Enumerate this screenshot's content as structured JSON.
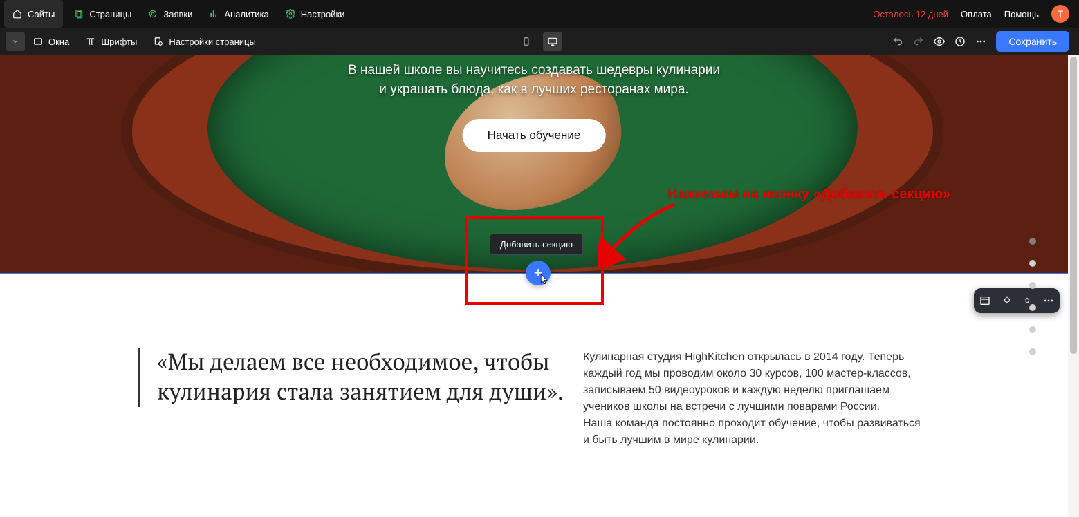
{
  "topbar": {
    "items": [
      {
        "label": "Сайты"
      },
      {
        "label": "Страницы"
      },
      {
        "label": "Заявки"
      },
      {
        "label": "Аналитика"
      },
      {
        "label": "Настройки"
      }
    ],
    "trial": "Осталось 12 дней",
    "payment": "Оплата",
    "help": "Помощь",
    "avatar_letter": "Т"
  },
  "secondbar": {
    "windows": "Окна",
    "fonts": "Шрифты",
    "page_settings": "Настройки страницы",
    "save": "Сохранить"
  },
  "hero": {
    "subtitle": "В нашей школе вы научитесь создавать шедевры кулинарии\nи украшать блюда, как в лучших ресторанах мира.",
    "cta_button": "Начать обучение"
  },
  "add_section": {
    "tooltip": "Добавить секцию",
    "plus": "+"
  },
  "annotation": "Нажимаем на иконку «Добавить секцию»",
  "about": {
    "quote": "«Мы делаем все необходимое, чтобы кулинария стала занятием для души».",
    "paragraph1": "Кулинарная студия HighKitchen открылась в 2014 году. Теперь каждый год мы проводим около 30 курсов, 100 мастер-классов, записываем 50 видеоуроков и каждую неделю приглашаем учеников школы на встречи с лучшими поварами России.",
    "paragraph2": "Наша команда постоянно проходит обучение, чтобы развиваться и быть лучшим в мире кулинарии."
  }
}
